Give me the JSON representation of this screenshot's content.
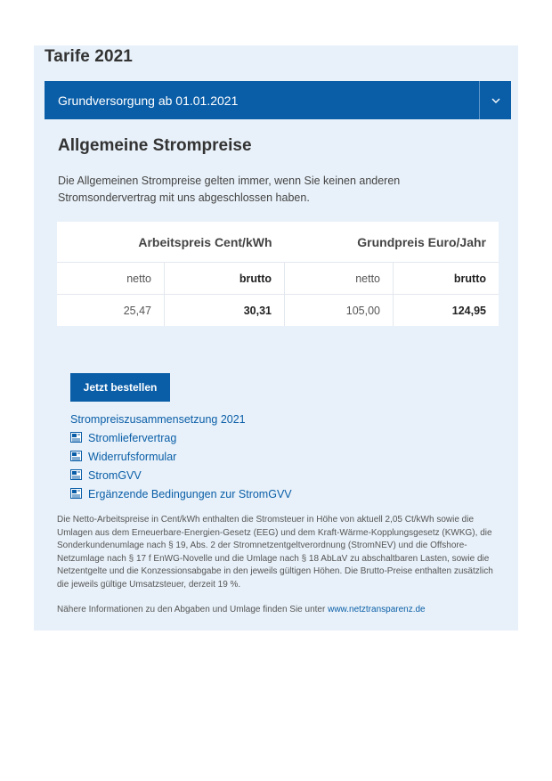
{
  "panel": {
    "title": "Tarife 2021",
    "accordion_label": "Grundversorgung ab 01.01.2021",
    "accordion_toggle_icon": "chevron-down-icon"
  },
  "section": {
    "title": "Allgemeine Strompreise",
    "intro": "Die Allgemeinen Strompreise gelten immer, wenn Sie keinen anderen Stromsondervertrag mit uns abgeschlossen haben."
  },
  "price_table": {
    "group_headers": [
      "Arbeitspreis Cent/kWh",
      "Grundpreis Euro/Jahr"
    ],
    "sub_headers": [
      "netto",
      "brutto",
      "netto",
      "brutto"
    ],
    "values": [
      "25,47",
      "30,31",
      "105,00",
      "124,95"
    ]
  },
  "actions": {
    "order_label": "Jetzt bestellen",
    "composition_link": "Strompreiszusammensetzung 2021"
  },
  "documents": [
    "Stromliefervertrag",
    "Widerrufsformular",
    "StromGVV",
    "Ergänzende Bedingungen zur StromGVV"
  ],
  "footnote": "Die Netto-Arbeitspreise in Cent/kWh enthalten die Stromsteuer in Höhe von aktuell 2,05 Ct/kWh sowie die Umlagen aus dem Erneuerbare-Energien-Gesetz (EEG) und dem Kraft-Wärme-Kopplungsgesetz (KWKG), die Sonderkundenumlage nach § 19, Abs. 2 der Stromnetzentgeltverordnung (StromNEV) und die Offshore-Netzumlage nach § 17 f EnWG-Novelle und die Umlage nach § 18 AbLaV zu abschaltbaren Lasten, sowie die Netzentgelte und die Konzessionsabgabe in den jeweils gültigen Höhen. Die Brutto-Preise enthalten zusätzlich die jeweils gültige Umsatzsteuer, derzeit 19 %.",
  "info": {
    "text": "Nähere Informationen zu den Abgaben und Umlage finden Sie unter ",
    "link": "www.netztransparenz.de"
  },
  "colors": {
    "accent": "#0a5ea8",
    "panel_background": "#e8f1f9"
  }
}
